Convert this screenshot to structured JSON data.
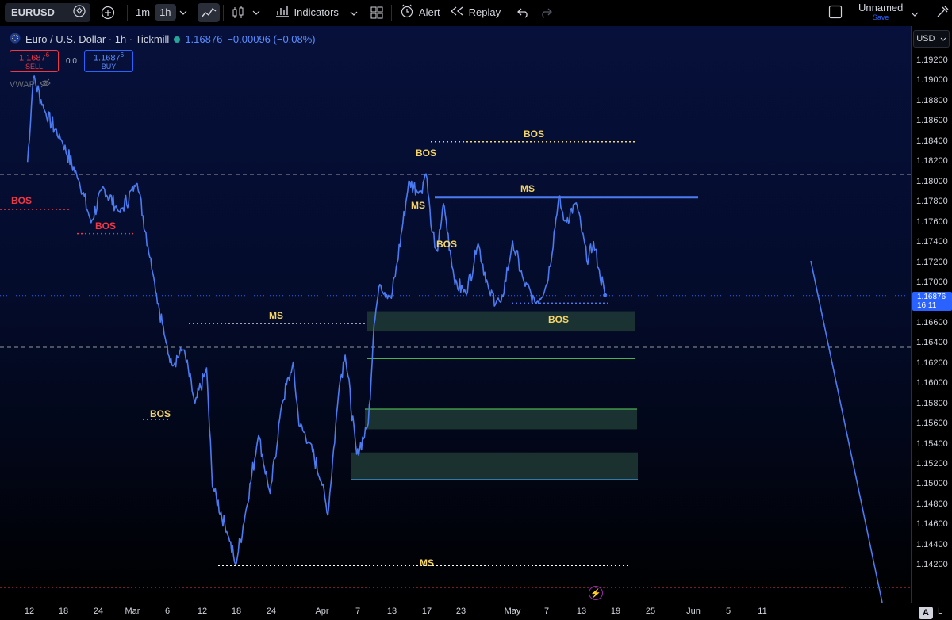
{
  "toolbar": {
    "symbol": "EURUSD",
    "timeframes": [
      "1m",
      "1h"
    ],
    "active_timeframe": "1h",
    "indicators_label": "Indicators",
    "alert_label": "Alert",
    "replay_label": "Replay",
    "layout_name": "Unnamed",
    "save_label": "Save",
    "icons": [
      "diamond-icon",
      "add-symbol-icon",
      "chevron-down-icon",
      "line-chart-icon",
      "candles-icon",
      "indicators-icon",
      "templates-icon",
      "alert-icon",
      "replay-icon",
      "undo-icon",
      "redo-icon",
      "fullscreen-icon",
      "camera-icon"
    ]
  },
  "legend": {
    "title": "Euro / U.S. Dollar · 1h · Tickmill",
    "price": "1.16876",
    "change": "−0.00096 (−0.08%)",
    "sell_price": "1.1687",
    "sell_super": "6",
    "sell_label": "SELL",
    "spread": "0.0",
    "buy_price": "1.1687",
    "buy_super": "6",
    "buy_label": "BUY",
    "vwap_label": "VWAP"
  },
  "price_axis": {
    "currency": "USD",
    "ticks": [
      "1.19200",
      "1.19000",
      "1.18800",
      "1.18600",
      "1.18400",
      "1.18200",
      "1.18000",
      "1.17800",
      "1.17600",
      "1.17400",
      "1.17200",
      "1.17000",
      "1.16600",
      "1.16400",
      "1.16200",
      "1.16000",
      "1.15800",
      "1.15600",
      "1.15400",
      "1.15200",
      "1.15000",
      "1.14800",
      "1.14600",
      "1.14400",
      "1.14200"
    ],
    "current_price": "1.16876",
    "countdown": "16:11"
  },
  "time_axis": {
    "ticks": [
      "12",
      "18",
      "24",
      "Mar",
      "6",
      "12",
      "18",
      "24",
      "Apr",
      "7",
      "13",
      "17",
      "23",
      "May",
      "7",
      "13",
      "19",
      "25",
      "Jun",
      "5",
      "11"
    ],
    "auto_label": "A",
    "log_label": "L"
  },
  "annotations": {
    "labels": [
      "BOS",
      "BOS",
      "BOS",
      "BOS",
      "MS",
      "BOS",
      "BOS",
      "MS",
      "BOS",
      "MS",
      "MS",
      "BOS"
    ]
  },
  "chart_data": {
    "type": "line",
    "series": [
      {
        "name": "EURUSD",
        "color": "#4c7bf0"
      }
    ],
    "ylim": [
      1.141,
      1.1936
    ],
    "x_start": "2026-02-09",
    "x_end": "2026-06-13",
    "key_points": [
      [
        "2026-02-09",
        1.182
      ],
      [
        "2026-02-10",
        1.1905
      ],
      [
        "2026-02-12",
        1.187
      ],
      [
        "2026-02-15",
        1.184
      ],
      [
        "2026-02-18",
        1.18
      ],
      [
        "2026-02-20",
        1.176
      ],
      [
        "2026-02-22",
        1.1795
      ],
      [
        "2026-02-25",
        1.177
      ],
      [
        "2026-02-28",
        1.18
      ],
      [
        "2026-03-03",
        1.17
      ],
      [
        "2026-03-05",
        1.164
      ],
      [
        "2026-03-06",
        1.162
      ],
      [
        "2026-03-08",
        1.1635
      ],
      [
        "2026-03-10",
        1.158
      ],
      [
        "2026-03-12",
        1.1615
      ],
      [
        "2026-03-13",
        1.15
      ],
      [
        "2026-03-16",
        1.1445
      ],
      [
        "2026-03-17",
        1.142
      ],
      [
        "2026-03-19",
        1.148
      ],
      [
        "2026-03-21",
        1.155
      ],
      [
        "2026-03-23",
        1.149
      ],
      [
        "2026-03-25",
        1.158
      ],
      [
        "2026-03-27",
        1.162
      ],
      [
        "2026-03-28",
        1.156
      ],
      [
        "2026-03-30",
        1.154
      ],
      [
        "2026-04-01",
        1.15
      ],
      [
        "2026-04-02",
        1.147
      ],
      [
        "2026-04-04",
        1.16
      ],
      [
        "2026-04-05",
        1.163
      ],
      [
        "2026-04-07",
        1.153
      ],
      [
        "2026-04-09",
        1.156
      ],
      [
        "2026-04-10",
        1.166
      ],
      [
        "2026-04-11",
        1.17
      ],
      [
        "2026-04-13",
        1.1685
      ],
      [
        "2026-04-14",
        1.172
      ],
      [
        "2026-04-15",
        1.176
      ],
      [
        "2026-04-16",
        1.18
      ],
      [
        "2026-04-18",
        1.179
      ],
      [
        "2026-04-19",
        1.181
      ],
      [
        "2026-04-20",
        1.175
      ],
      [
        "2026-04-21",
        1.173
      ],
      [
        "2026-04-22",
        1.178
      ],
      [
        "2026-04-24",
        1.17
      ],
      [
        "2026-04-26",
        1.169
      ],
      [
        "2026-04-28",
        1.174
      ],
      [
        "2026-04-30",
        1.169
      ],
      [
        "2026-05-02",
        1.168
      ],
      [
        "2026-05-04",
        1.174
      ],
      [
        "2026-05-06",
        1.17
      ],
      [
        "2026-05-08",
        1.168
      ],
      [
        "2026-05-10",
        1.17
      ],
      [
        "2026-05-12",
        1.1785
      ],
      [
        "2026-05-13",
        1.176
      ],
      [
        "2026-05-15",
        1.178
      ],
      [
        "2026-05-16",
        1.175
      ],
      [
        "2026-05-17",
        1.172
      ],
      [
        "2026-05-18",
        1.174
      ],
      [
        "2026-05-19",
        1.1712
      ],
      [
        "2026-05-20",
        1.1688
      ]
    ],
    "horizontal_levels": [
      {
        "label": "BOS",
        "price": 1.184,
        "color": "#f5d565",
        "style": "dotted"
      },
      {
        "label": "MS",
        "price": 1.1785,
        "color": "#4c7bf0",
        "style": "solid"
      },
      {
        "label": "BOS",
        "price": 1.168,
        "color": "#4c7bf0",
        "style": "dotted"
      },
      {
        "label": "MS",
        "price": 1.166,
        "color": "#ffffff",
        "style": "dotted"
      },
      {
        "label": "BOS",
        "price": 1.1565,
        "color": "#ffffff",
        "style": "dotted"
      },
      {
        "label": "MS",
        "price": 1.142,
        "color": "#ffffff",
        "style": "dotted"
      },
      {
        "label": "BOS",
        "price": 1.1773,
        "color": "#f23645",
        "style": "dotted"
      },
      {
        "label": "BOS",
        "price": 1.1749,
        "color": "#f23645",
        "style": "dotted"
      }
    ],
    "zones": [
      {
        "from": 1.1652,
        "to": 1.1672,
        "color": "#1f3a35"
      },
      {
        "from": 1.1555,
        "to": 1.1575,
        "color": "#1f3a35"
      },
      {
        "from": 1.1505,
        "to": 1.1532,
        "color": "#1f3a35"
      }
    ],
    "grid": false
  }
}
